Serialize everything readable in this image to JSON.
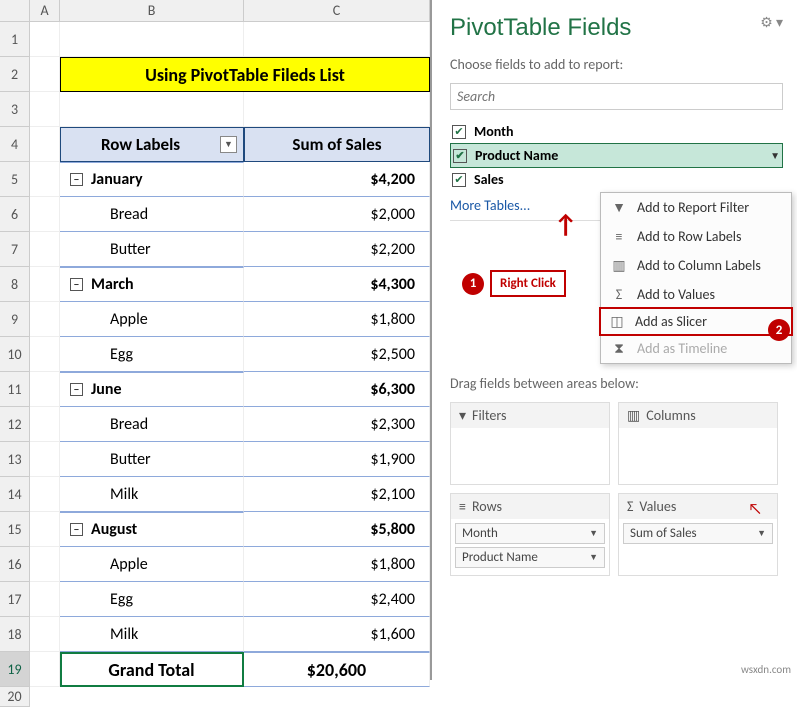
{
  "columns": {
    "A": "A",
    "B": "B",
    "C": "C"
  },
  "row_numbers": [
    "1",
    "2",
    "3",
    "4",
    "5",
    "6",
    "7",
    "8",
    "9",
    "10",
    "11",
    "12",
    "13",
    "14",
    "15",
    "16",
    "17",
    "18",
    "19",
    "20"
  ],
  "title": "Using PivotTable Fileds List",
  "headers": {
    "row_labels": "Row Labels",
    "sum_of_sales": "Sum of Sales"
  },
  "pivot": [
    {
      "type": "group",
      "label": "January",
      "value": "$4,200"
    },
    {
      "type": "item",
      "label": "Bread",
      "value": "$2,000"
    },
    {
      "type": "item",
      "label": "Butter",
      "value": "$2,200"
    },
    {
      "type": "group",
      "label": "March",
      "value": "$4,300"
    },
    {
      "type": "item",
      "label": "Apple",
      "value": "$1,800"
    },
    {
      "type": "item",
      "label": "Egg",
      "value": "$2,500"
    },
    {
      "type": "group",
      "label": "June",
      "value": "$6,300"
    },
    {
      "type": "item",
      "label": "Bread",
      "value": "$2,300"
    },
    {
      "type": "item",
      "label": "Butter",
      "value": "$1,900"
    },
    {
      "type": "item",
      "label": "Milk",
      "value": "$2,100"
    },
    {
      "type": "group",
      "label": "August",
      "value": "$5,800"
    },
    {
      "type": "item",
      "label": "Apple",
      "value": "$1,800"
    },
    {
      "type": "item",
      "label": "Egg",
      "value": "$2,400"
    },
    {
      "type": "item",
      "label": "Milk",
      "value": "$1,600"
    }
  ],
  "grand_total": {
    "label": "Grand Total",
    "value": "$20,600"
  },
  "panel": {
    "title": "PivotTable Fields",
    "subtitle": "Choose fields to add to report:",
    "search_placeholder": "Search",
    "fields": [
      {
        "name": "Month",
        "checked": true,
        "hover": false
      },
      {
        "name": "Product Name",
        "checked": true,
        "hover": true
      },
      {
        "name": "Sales",
        "checked": true,
        "hover": false
      }
    ],
    "more": "More Tables...",
    "drag_label": "Drag fields between areas below:",
    "areas": {
      "filters": {
        "label": "Filters",
        "items": []
      },
      "columns": {
        "label": "Columns",
        "items": []
      },
      "rows": {
        "label": "Rows",
        "items": [
          "Month",
          "Product Name"
        ]
      },
      "values": {
        "label": "Values",
        "items": [
          "Sum of Sales"
        ]
      }
    }
  },
  "context_menu": [
    {
      "icon": "filter",
      "label": "Add to Report Filter",
      "disabled": false
    },
    {
      "icon": "rows",
      "label": "Add to Row Labels",
      "disabled": false
    },
    {
      "icon": "cols",
      "label": "Add to Column Labels",
      "disabled": false
    },
    {
      "icon": "sigma",
      "label": "Add to Values",
      "disabled": false
    },
    {
      "icon": "slicer",
      "label": "Add as Slicer",
      "disabled": false,
      "highlight": true
    },
    {
      "icon": "timeline",
      "label": "Add as Timeline",
      "disabled": true
    }
  ],
  "callouts": {
    "step1": "1",
    "step1_label": "Right Click",
    "step2": "2"
  },
  "watermark": "wsxdn.com"
}
